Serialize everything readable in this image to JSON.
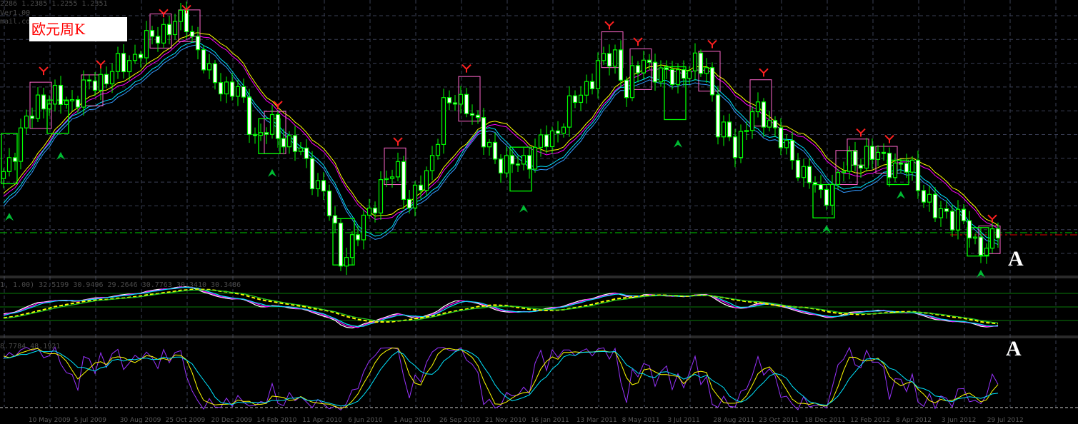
{
  "header": {
    "ohlc": "2286 1.2385 1.2255 1.2351",
    "version": "Ver1.00",
    "contact": "mail.com"
  },
  "title_label": "欧元周K",
  "marker_a_main": "A",
  "marker_a_sub": "A",
  "indicator1_values": "1, 1.00) 32.5199 30.9496 29.2646 30.7763 30.3410 30.3486",
  "indicator2_values": "8.7784 48.1921",
  "colors": {
    "candle": "#00ff00",
    "bear_body": "#ffffff",
    "ma_yellow": "#ffff00",
    "ma_magenta": "#ff00ff",
    "ma_cyan": "#00e5ff",
    "ma_blue": "#3399ff",
    "signal_top_box": "#ff66cc",
    "signal_bottom_box": "#00ff00",
    "stoch": "#9933ff",
    "grid": "#3a3f55"
  },
  "chart_data": {
    "type": "candlestick",
    "title": "欧元周K",
    "timeframe": "weekly",
    "ylim": [
      1.19,
      1.515
    ],
    "last_close": 1.2351,
    "level_line": 1.2417,
    "x_tick_labels": [
      "2009",
      "10 May 2009",
      "5 Jul 2009",
      "30 Aug 2009",
      "25 Oct 2009",
      "20 Dec 2009",
      "14 Feb 2010",
      "11 Apr 2010",
      "6 Jun 2010",
      "1 Aug 2010",
      "26 Sep 2010",
      "21 Nov 2010",
      "16 Jan 2011",
      "13 Mar 2011",
      "8 May 2011",
      "3 Jul 2011",
      "28 Aug 2011",
      "23 Oct 2011",
      "18 Dec 2011",
      "12 Feb 2012",
      "8 Apr 2012",
      "3 Jun 2012",
      "29 Jul 2012"
    ],
    "close_anchors": [
      [
        -14,
        1.25
      ],
      [
        -6,
        1.28
      ],
      [
        0,
        1.317
      ],
      [
        6,
        1.405
      ],
      [
        12,
        1.405
      ],
      [
        16,
        1.427
      ],
      [
        21,
        1.449
      ],
      [
        28,
        1.493
      ],
      [
        32,
        1.502
      ],
      [
        36,
        1.432
      ],
      [
        41,
        1.414
      ],
      [
        44,
        1.361
      ],
      [
        47,
        1.37
      ],
      [
        51,
        1.348
      ],
      [
        56,
        1.291
      ],
      [
        59,
        1.212
      ],
      [
        62,
        1.238
      ],
      [
        66,
        1.3
      ],
      [
        69,
        1.317
      ],
      [
        71,
        1.278
      ],
      [
        74,
        1.309
      ],
      [
        77,
        1.397
      ],
      [
        81,
        1.405
      ],
      [
        84,
        1.353
      ],
      [
        88,
        1.322
      ],
      [
        91,
        1.331
      ],
      [
        96,
        1.361
      ],
      [
        101,
        1.414
      ],
      [
        104,
        1.445
      ],
      [
        107,
        1.462
      ],
      [
        109,
        1.414
      ],
      [
        112,
        1.458
      ],
      [
        115,
        1.432
      ],
      [
        119,
        1.44
      ],
      [
        123,
        1.449
      ],
      [
        125,
        1.37
      ],
      [
        128,
        1.348
      ],
      [
        131,
        1.388
      ],
      [
        134,
        1.383
      ],
      [
        137,
        1.339
      ],
      [
        141,
        1.309
      ],
      [
        143,
        1.282
      ],
      [
        147,
        1.322
      ],
      [
        151,
        1.339
      ],
      [
        154,
        1.331
      ],
      [
        157,
        1.322
      ],
      [
        159,
        1.317
      ],
      [
        163,
        1.264
      ],
      [
        167,
        1.264
      ],
      [
        170,
        1.225
      ],
      [
        174,
        1.2351
      ]
    ],
    "weeks": 175,
    "moving_averages": [
      {
        "name": "MA yellow",
        "period": 12,
        "offset": 0.004
      },
      {
        "name": "MA magenta",
        "period": 12,
        "offset": 0
      },
      {
        "name": "MA cyan",
        "period": 10,
        "offset": -0.012
      },
      {
        "name": "MA blue",
        "period": 10,
        "offset": -0.016
      }
    ],
    "top_signal_boxes": [
      [
        5,
        8,
        1.427,
        1.37
      ],
      [
        14,
        17,
        1.436,
        1.398
      ],
      [
        26,
        29,
        1.511,
        1.469
      ],
      [
        31,
        34,
        1.516,
        1.477
      ],
      [
        46,
        49,
        1.391,
        1.339
      ],
      [
        67,
        70,
        1.346,
        1.301
      ],
      [
        80,
        83,
        1.434,
        1.379
      ],
      [
        105,
        108,
        1.489,
        1.445
      ],
      [
        110,
        113,
        1.468,
        1.418
      ],
      [
        122,
        125,
        1.465,
        1.416
      ],
      [
        131,
        134,
        1.43,
        1.373
      ],
      [
        146,
        149,
        1.343,
        1.301
      ],
      [
        148,
        151,
        1.357,
        1.325
      ],
      [
        153,
        156,
        1.348,
        1.315
      ],
      [
        171,
        174,
        1.25,
        1.216
      ]
    ],
    "bottom_signal_boxes": [
      [
        0,
        2,
        1.364,
        1.302
      ],
      [
        8,
        11,
        1.405,
        1.364
      ],
      [
        45,
        48,
        1.382,
        1.339
      ],
      [
        58,
        61,
        1.259,
        1.202
      ],
      [
        89,
        92,
        1.347,
        1.293
      ],
      [
        116,
        119,
        1.446,
        1.381
      ],
      [
        142,
        145,
        1.301,
        1.26
      ],
      [
        155,
        158,
        1.331,
        1.301
      ],
      [
        169,
        172,
        1.248,
        1.213
      ]
    ],
    "buy_arrows": [
      [
        1,
        1.26
      ],
      [
        10,
        1.335
      ],
      [
        47,
        1.314
      ],
      [
        91,
        1.27
      ],
      [
        118,
        1.35
      ],
      [
        144,
        1.245
      ],
      [
        157,
        1.287
      ],
      [
        171,
        1.19
      ]
    ],
    "sell_marks": [
      [
        7,
        1.442
      ],
      [
        17,
        1.45
      ],
      [
        28,
        1.513
      ],
      [
        32,
        1.518
      ],
      [
        48,
        1.4
      ],
      [
        69,
        1.355
      ],
      [
        81,
        1.445
      ],
      [
        106,
        1.498
      ],
      [
        111,
        1.478
      ],
      [
        124,
        1.475
      ],
      [
        133,
        1.44
      ],
      [
        150,
        1.366
      ],
      [
        155,
        1.358
      ],
      [
        173,
        1.26
      ]
    ],
    "panels": [
      {
        "name": "oscillator",
        "lines": [
          "white",
          "magenta",
          "cyan",
          "yellow",
          "green"
        ],
        "levels": 3
      },
      {
        "name": "stochastic",
        "lines": [
          "purple %K",
          "yellow",
          "cyan"
        ],
        "ylim": [
          0,
          100
        ]
      }
    ]
  }
}
